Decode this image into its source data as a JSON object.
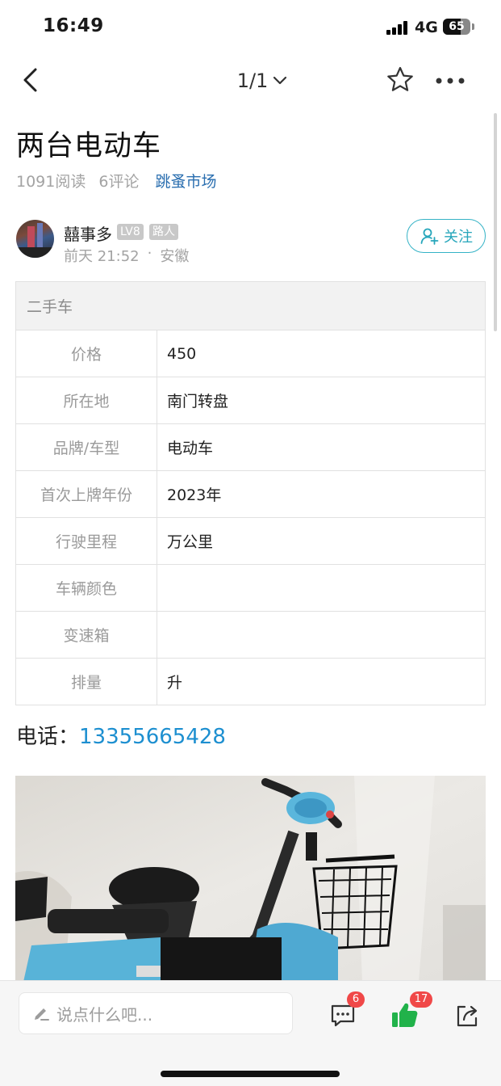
{
  "status_bar": {
    "time": "16:49",
    "network": "4G",
    "battery": "65"
  },
  "nav": {
    "pager": "1/1"
  },
  "post": {
    "title": "两台电动车",
    "reads": "1091阅读",
    "comments": "6评论",
    "category": "跳蚤市场"
  },
  "author": {
    "name": "囍事多",
    "level": "LV8",
    "role": "路人",
    "time": "前天 21:52",
    "dot": "·",
    "location": "安徽",
    "follow_label": "关注"
  },
  "spec": {
    "header": "二手车",
    "rows": [
      {
        "key": "价格",
        "value": "450"
      },
      {
        "key": "所在地",
        "value": "南门转盘"
      },
      {
        "key": "品牌/车型",
        "value": "电动车"
      },
      {
        "key": "首次上牌年份",
        "value": "2023年"
      },
      {
        "key": "行驶里程",
        "value": "万公里"
      },
      {
        "key": "车辆颜色",
        "value": ""
      },
      {
        "key": "变速箱",
        "value": ""
      },
      {
        "key": "排量",
        "value": "升"
      }
    ]
  },
  "contact": {
    "label": "电话：",
    "phone": "13355665428"
  },
  "bottom_bar": {
    "comment_placeholder": "说点什么吧...",
    "comment_count": "6",
    "like_count": "17"
  },
  "colors": {
    "accent": "#26a6bb",
    "link": "#1d8fd0",
    "category": "#2b6fb0",
    "like": "#21b24a",
    "badge": "#f04848"
  }
}
